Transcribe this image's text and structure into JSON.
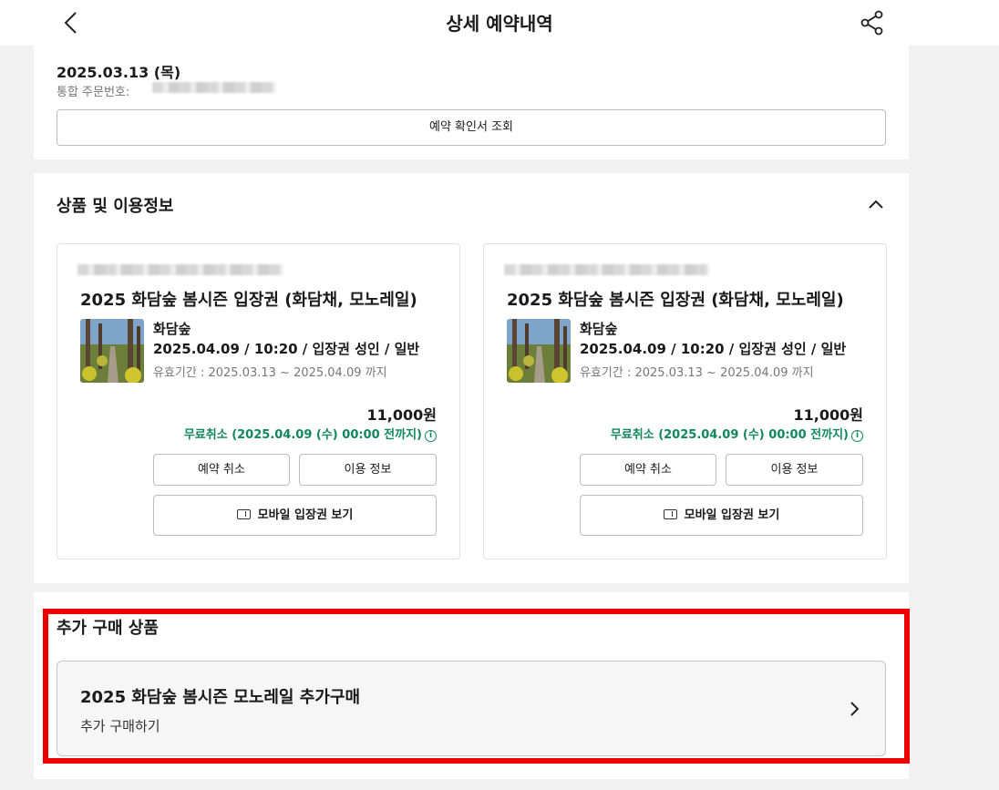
{
  "header": {
    "title": "상세 예약내역",
    "back_icon": "chevron-left-icon",
    "share_icon": "share-icon"
  },
  "order": {
    "date": "2025.03.13 (목)",
    "number_label": "통합 주문번호:",
    "confirm_button": "예약 확인서 조회"
  },
  "products": {
    "section_title": "상품 및 이용정보",
    "collapse_icon": "chevron-up-icon",
    "items": [
      {
        "title": "2025 화담숲 봄시즌 입장권 (화담채, 모노레일)",
        "place": "화담숲",
        "detail": "2025.04.09 / 10:20 / 입장권 성인 / 일반",
        "validity": "유효기간 : 2025.03.13 ~ 2025.04.09 까지",
        "price": "11,000원",
        "free_cancel": "무료취소 (2025.04.09 (수) 00:00 전까지)",
        "cancel_button": "예약 취소",
        "info_button": "이용 정보",
        "mobile_ticket_button": "모바일 입장권 보기"
      },
      {
        "title": "2025 화담숲 봄시즌 입장권 (화담채, 모노레일)",
        "place": "화담숲",
        "detail": "2025.04.09 / 10:20 / 입장권 성인 / 일반",
        "validity": "유효기간 : 2025.03.13 ~ 2025.04.09 까지",
        "price": "11,000원",
        "free_cancel": "무료취소 (2025.04.09 (수) 00:00 전까지)",
        "cancel_button": "예약 취소",
        "info_button": "이용 정보",
        "mobile_ticket_button": "모바일 입장권 보기"
      }
    ]
  },
  "addon": {
    "section_title": "추가 구매 상품",
    "item_title": "2025 화담숲 봄시즌 모노레일 추가구매",
    "item_subtitle": "추가 구매하기",
    "chevron_icon": "chevron-right-icon"
  },
  "colors": {
    "highlight_border": "#ee0000",
    "free_cancel_text": "#11875b",
    "page_background": "#f1f1f1"
  }
}
